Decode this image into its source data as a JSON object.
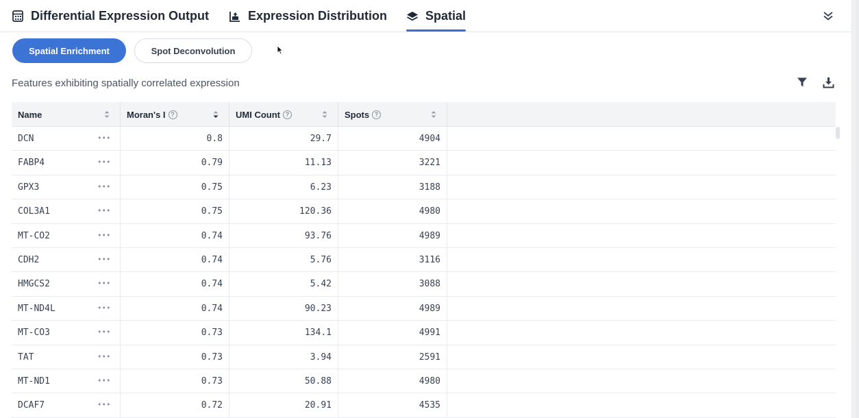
{
  "tabs": [
    {
      "label": "Differential Expression Output",
      "icon": "calculator-icon"
    },
    {
      "label": "Expression Distribution",
      "icon": "chart-upload-icon"
    },
    {
      "label": "Spatial",
      "icon": "layers-icon",
      "active": true
    }
  ],
  "subtabs": [
    {
      "label": "Spatial Enrichment",
      "active": true
    },
    {
      "label": "Spot Deconvolution",
      "active": false
    }
  ],
  "subtitle": "Features exhibiting spatially correlated expression",
  "colors": {
    "accent": "#3c74d6",
    "header_bg": "#f3f4f6"
  },
  "table": {
    "columns": [
      {
        "label": "Name",
        "help": false
      },
      {
        "label": "Moran's I",
        "help": true
      },
      {
        "label": "UMI Count",
        "help": true
      },
      {
        "label": "Spots",
        "help": true
      }
    ],
    "rows": [
      {
        "name": "DCN",
        "moran": "0.8",
        "umi": "29.7",
        "spots": "4904"
      },
      {
        "name": "FABP4",
        "moran": "0.79",
        "umi": "11.13",
        "spots": "3221"
      },
      {
        "name": "GPX3",
        "moran": "0.75",
        "umi": "6.23",
        "spots": "3188"
      },
      {
        "name": "COL3A1",
        "moran": "0.75",
        "umi": "120.36",
        "spots": "4980"
      },
      {
        "name": "MT-CO2",
        "moran": "0.74",
        "umi": "93.76",
        "spots": "4989"
      },
      {
        "name": "CDH2",
        "moran": "0.74",
        "umi": "5.76",
        "spots": "3116"
      },
      {
        "name": "HMGCS2",
        "moran": "0.74",
        "umi": "5.42",
        "spots": "3088"
      },
      {
        "name": "MT-ND4L",
        "moran": "0.74",
        "umi": "90.23",
        "spots": "4989"
      },
      {
        "name": "MT-CO3",
        "moran": "0.73",
        "umi": "134.1",
        "spots": "4991"
      },
      {
        "name": "TAT",
        "moran": "0.73",
        "umi": "3.94",
        "spots": "2591"
      },
      {
        "name": "MT-ND1",
        "moran": "0.73",
        "umi": "50.88",
        "spots": "4980"
      },
      {
        "name": "DCAF7",
        "moran": "0.72",
        "umi": "20.91",
        "spots": "4535"
      }
    ]
  }
}
